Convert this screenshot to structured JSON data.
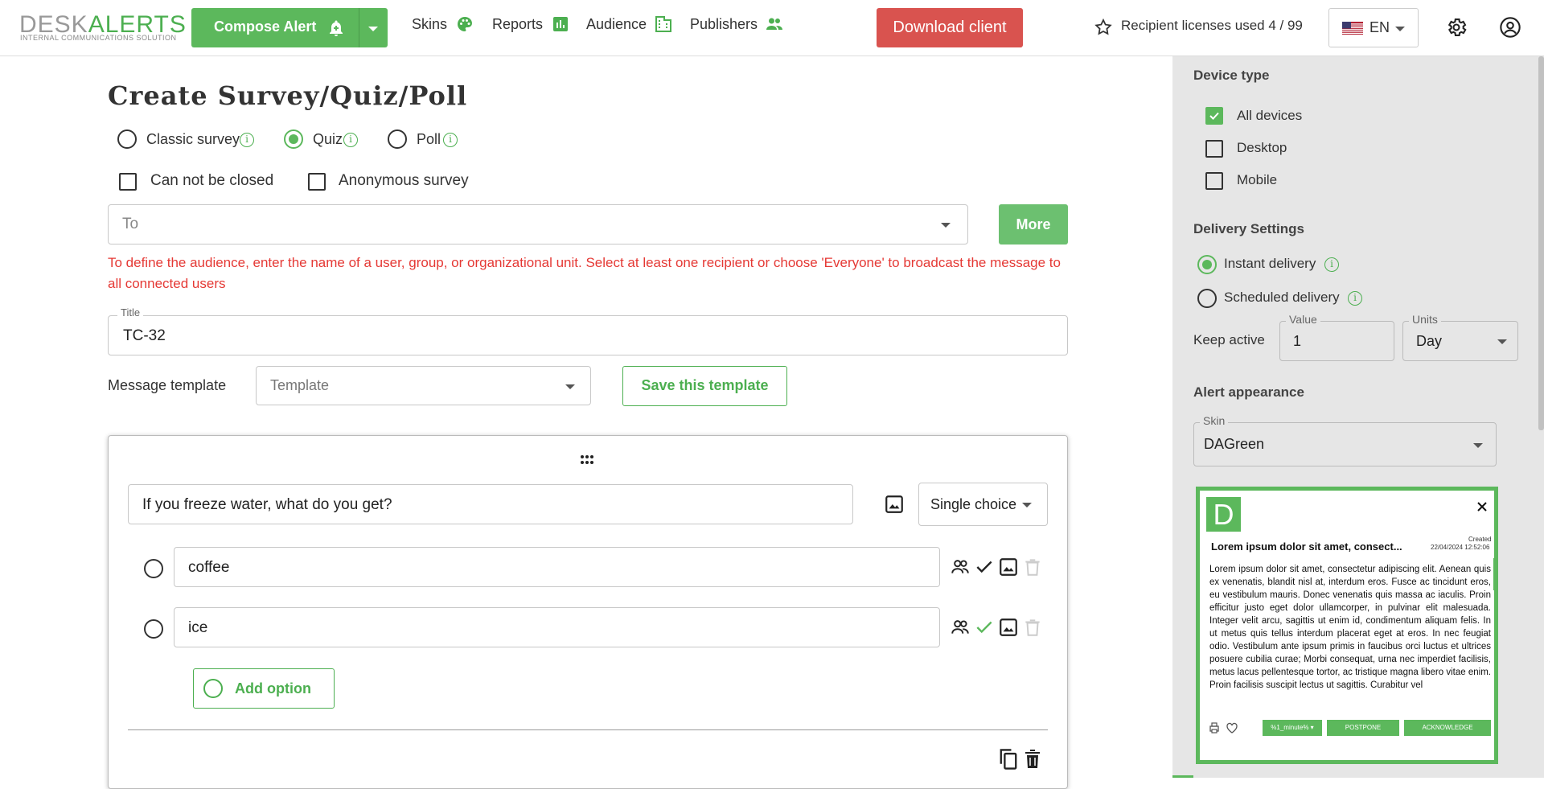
{
  "header": {
    "logo_desk": "DESK",
    "logo_alerts": "ALERTS",
    "logo_tagline": "INTERNAL COMMUNICATIONS SOLUTION",
    "compose_label": "Compose Alert",
    "nav": [
      {
        "label": "Skins",
        "icon": "palette-icon"
      },
      {
        "label": "Reports",
        "icon": "bar-chart-icon"
      },
      {
        "label": "Audience",
        "icon": "building-icon"
      },
      {
        "label": "Publishers",
        "icon": "people-icon"
      }
    ],
    "download_label": "Download client",
    "licenses_label": "Recipient licenses used 4 / 99",
    "language": "EN"
  },
  "main": {
    "title": "Create Survey/Quiz/Poll",
    "survey_types": [
      {
        "label": "Classic survey",
        "selected": false
      },
      {
        "label": "Quiz",
        "selected": true
      },
      {
        "label": "Poll",
        "selected": false
      }
    ],
    "options": [
      {
        "label": "Can not be closed",
        "checked": false
      },
      {
        "label": "Anonymous survey",
        "checked": false
      }
    ],
    "to_placeholder": "To",
    "more_label": "More",
    "audience_error": "To define the audience, enter the name of a user, group, or organizational unit. Select at least one recipient or choose 'Everyone' to broadcast the message to all connected users",
    "title_label": "Title",
    "title_value": "TC-32",
    "template_label": "Message template",
    "template_placeholder": "Template",
    "save_template_label": "Save this template",
    "question": {
      "text": "If you freeze water, what do you get?",
      "type": "Single choice",
      "answers": [
        {
          "text": "coffee",
          "correct": false
        },
        {
          "text": "ice",
          "correct": true
        }
      ],
      "add_option_label": "Add option"
    }
  },
  "sidebar": {
    "device_type_heading": "Device type",
    "devices": [
      {
        "label": "All devices",
        "checked": true
      },
      {
        "label": "Desktop",
        "checked": false
      },
      {
        "label": "Mobile",
        "checked": false
      }
    ],
    "delivery_heading": "Delivery Settings",
    "delivery": [
      {
        "label": "Instant delivery",
        "selected": true
      },
      {
        "label": "Scheduled delivery",
        "selected": false
      }
    ],
    "keep_active_label": "Keep active",
    "value_label": "Value",
    "value": "1",
    "units_label": "Units",
    "units_value": "Day",
    "appearance_heading": "Alert appearance",
    "skin_label": "Skin",
    "skin_value": "DAGreen"
  },
  "preview": {
    "logo_letter": "D",
    "title": "Lorem ipsum dolor sit amet, consect...",
    "created_label": "Created",
    "created_date": "22/04/2024 12:52:06",
    "body": "Lorem ipsum dolor sit amet, consectetur adipiscing elit. Aenean quis ex venenatis, blandit nisl at, interdum eros. Fusce ac tincidunt eros, eu vestibulum mauris. Donec venenatis quis massa ac iaculis. Proin efficitur justo eget dolor ullamcorper, in pulvinar elit malesuada. Integer velit arcu, sagittis ut enim id, condimentum aliquam felis. In ut metus quis tellus interdum placerat eget at eros. In nec feugiat odio. Vestibulum ante ipsum primis in faucibus orci luctus et ultrices posuere cubilia curae; Morbi consequat, urna nec imperdiet facilisis, metus lacus pellentesque tortor, ac tristique magna libero vitae enim. Proin facilisis suscipit lectus ut sagittis. Curabitur vel",
    "postpone_select": "%1_minute%",
    "postpone_label": "POSTPONE",
    "acknowledge_label": "ACKNOWLEDGE"
  },
  "colors": {
    "accent": "#5cb85c",
    "danger": "#d9534f",
    "error_text": "#e53935"
  }
}
